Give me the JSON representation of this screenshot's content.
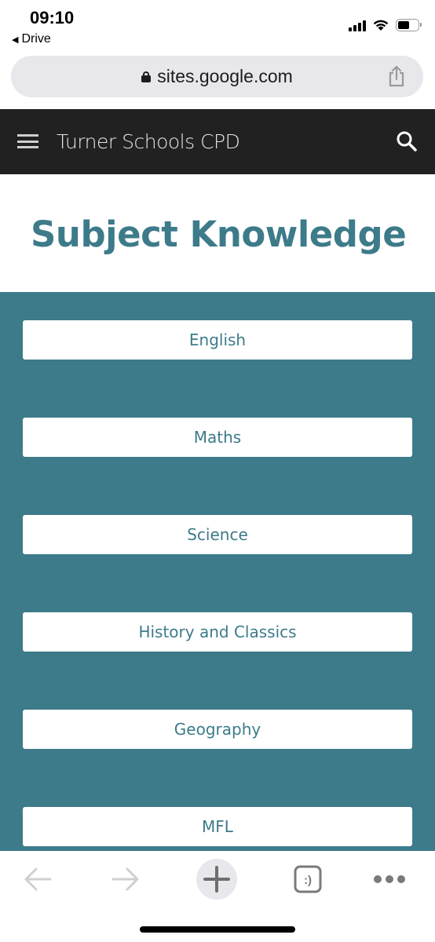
{
  "status_bar": {
    "time": "09:10",
    "back_app": "Drive",
    "battery_level": 0.6,
    "signal_bars": 4
  },
  "browser": {
    "url": "sites.google.com",
    "lock_icon": "lock-icon",
    "share_icon": "share-icon"
  },
  "site_header": {
    "menu_icon": "hamburger-menu-icon",
    "title": "Turner Schools CPD",
    "search_icon": "search-icon"
  },
  "page": {
    "title": "Subject Knowledge",
    "accent_color": "#3d7b8a",
    "subjects": [
      {
        "label": "English"
      },
      {
        "label": "Maths"
      },
      {
        "label": "Science"
      },
      {
        "label": "History and Classics"
      },
      {
        "label": "Geography"
      },
      {
        "label": "MFL"
      }
    ]
  },
  "toolbar": {
    "items": [
      {
        "icon": "back-arrow-icon",
        "enabled": false
      },
      {
        "icon": "forward-arrow-icon",
        "enabled": false
      },
      {
        "icon": "new-tab-plus-icon",
        "enabled": true
      },
      {
        "icon": "tab-switcher-icon",
        "glyph": ":)",
        "enabled": true
      },
      {
        "icon": "more-menu-icon",
        "enabled": true
      }
    ]
  }
}
